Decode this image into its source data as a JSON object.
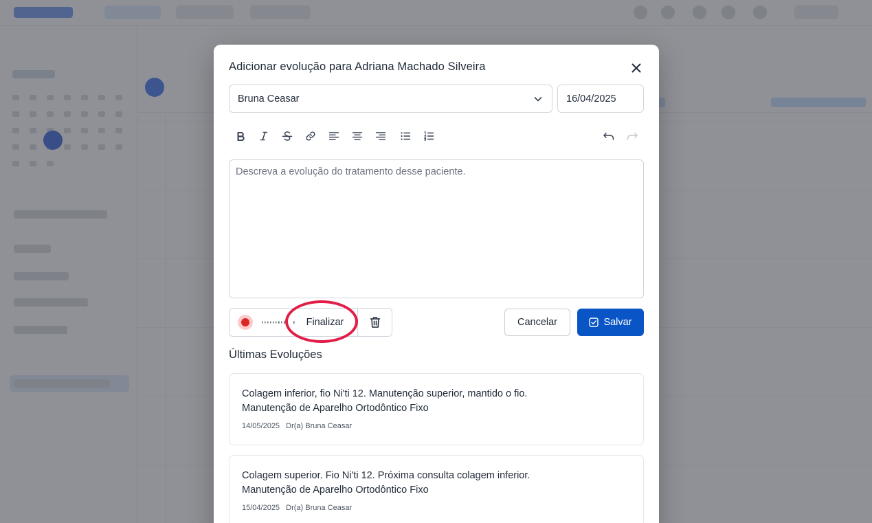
{
  "modal": {
    "title": "Adicionar evolução para Adriana Machado Silveira",
    "professional_select": {
      "value": "Bruna Ceasar"
    },
    "date_field": {
      "value": "16/04/2025"
    },
    "editor": {
      "placeholder": "Descreva a evolução do tratamento desse paciente."
    },
    "toolbar": {
      "icons": [
        "bold-icon",
        "italic-icon",
        "strikethrough-icon",
        "link-icon",
        "align-left-icon",
        "align-center-icon",
        "align-right-icon",
        "bullet-list-icon",
        "numbered-list-icon",
        "undo-icon",
        "redo-icon"
      ]
    },
    "recorder": {
      "status": "recording",
      "finalize_label": "Finalizar"
    },
    "actions": {
      "cancel_label": "Cancelar",
      "save_label": "Salvar"
    },
    "history": {
      "title": "Últimas Evoluções",
      "items": [
        {
          "text": "Colagem inferior, fio Ni'ti 12. Manutenção superior, mantido o fio.",
          "procedure": "Manutenção de Aparelho Ortodôntico Fixo",
          "date": "14/05/2025",
          "author": "Dr(a) Bruna Ceasar"
        },
        {
          "text": "Colagem superior. Fio Ni'ti 12. Próxima consulta colagem inferior.",
          "procedure": "Manutenção de Aparelho Ortodôntico Fixo",
          "date": "15/04/2025",
          "author": "Dr(a) Bruna Ceasar"
        }
      ]
    }
  },
  "colors": {
    "primary": "#0a55c6",
    "recording": "#dc2626",
    "highlight": "#e11d48",
    "overlay": "rgba(74,78,86,0.62)"
  }
}
